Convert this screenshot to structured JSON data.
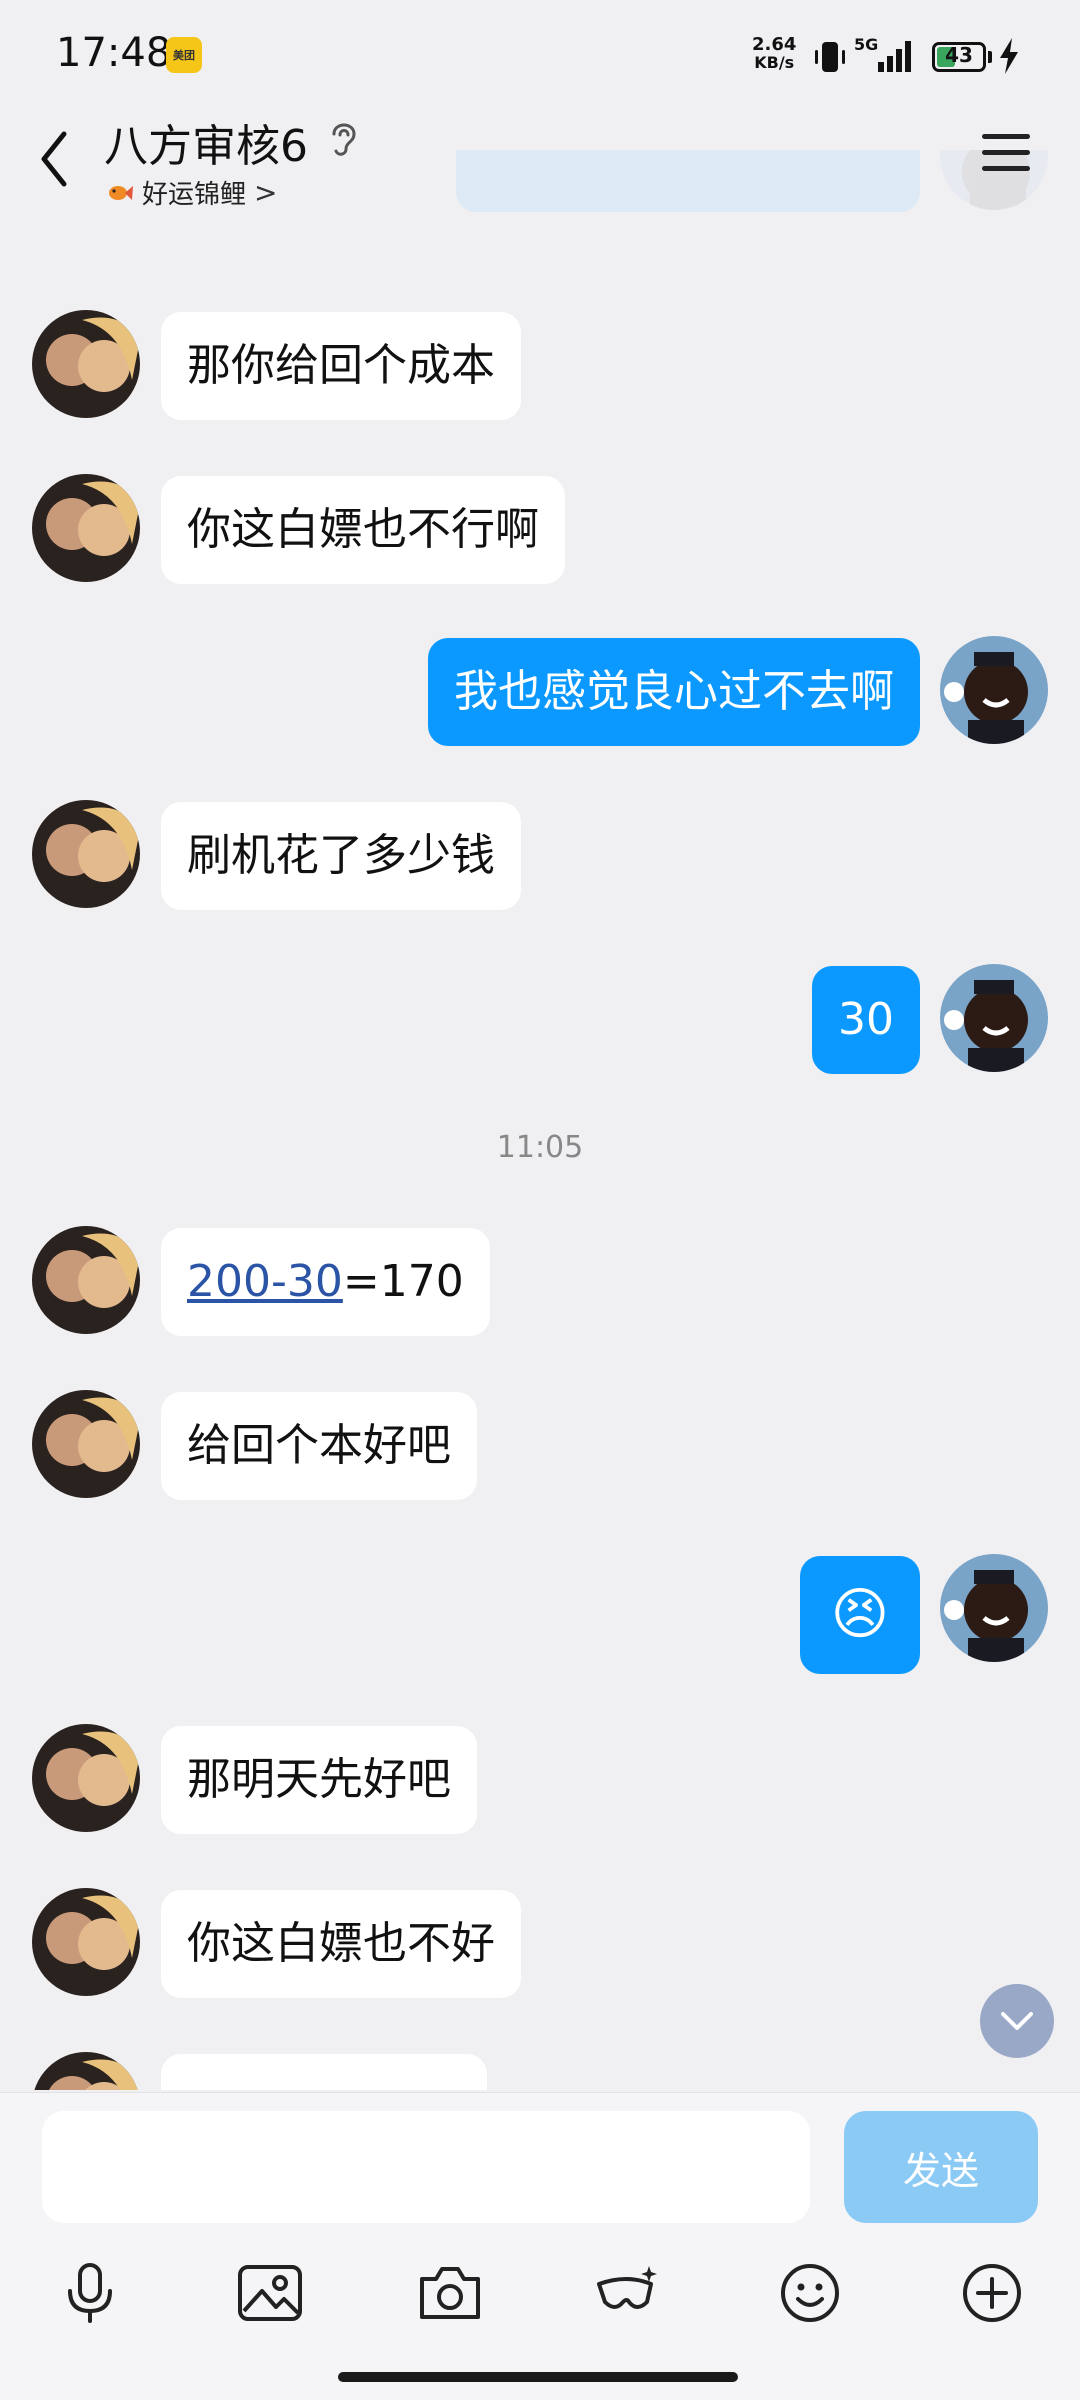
{
  "status_bar": {
    "time": "17:48",
    "app_badge": "美团",
    "net_speed_value": "2.64",
    "net_speed_unit": "KB/s",
    "network": "5G",
    "battery": "43"
  },
  "header": {
    "title": "八方审核6",
    "subtitle": "好运锦鲤",
    "subtitle_chevron": ">"
  },
  "messages": [
    {
      "side": "in",
      "text": "那你给回个成本"
    },
    {
      "side": "in",
      "text": "你这白嫖也不行啊"
    },
    {
      "side": "out",
      "text": "我也感觉良心过不去啊"
    },
    {
      "side": "in",
      "text": "刷机花了多少钱"
    },
    {
      "side": "out",
      "text": "30"
    },
    {
      "timestamp": "11:05"
    },
    {
      "side": "in",
      "link": "200-30",
      "text": "=170"
    },
    {
      "side": "in",
      "text": "给回个本好吧"
    },
    {
      "side": "out",
      "emoji": "😣"
    },
    {
      "side": "in",
      "text": "那明天先好吧"
    },
    {
      "side": "in",
      "text": "你这白嫖也不好"
    }
  ],
  "input": {
    "placeholder": "",
    "value": "",
    "send_label": "发送"
  },
  "toolbar_icons": [
    "microphone-icon",
    "image-icon",
    "camera-icon",
    "red-packet-icon",
    "emoji-icon",
    "plus-icon"
  ],
  "colors": {
    "outgoing_bubble": "#0b99ff",
    "incoming_bubble": "#ffffff",
    "background": "#f0f0f3",
    "send_disabled": "#8ccaf6",
    "link": "#2b54a6"
  }
}
